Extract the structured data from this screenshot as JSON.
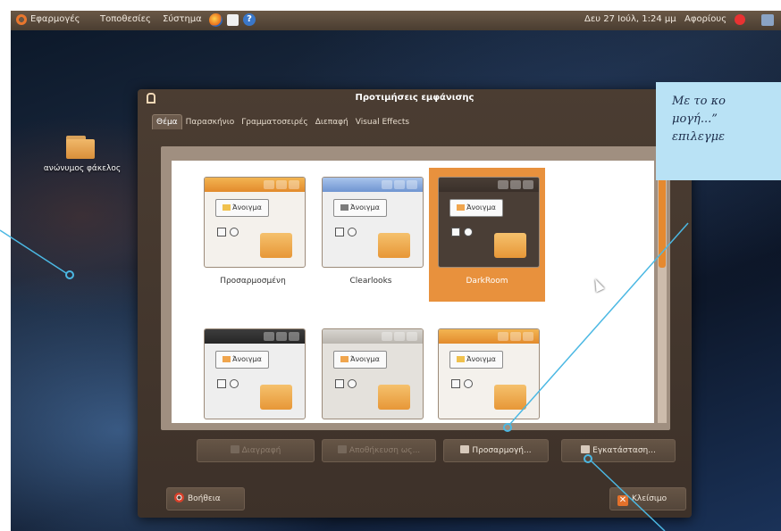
{
  "panel": {
    "menu": [
      "Εφαρμογές",
      "Τοποθεσίες",
      "Σύστημα"
    ],
    "clock": "Δευ 27 Ιούλ, 1:24 μμ",
    "user": "Αφορίους"
  },
  "desktop": {
    "folder_label": "ανώνυμος φάκελος"
  },
  "dialog": {
    "title": "Προτιμήσεις εμφάνισης",
    "tabs": [
      "Θέμα",
      "Παρασκήνιο",
      "Γραμματοσειρές",
      "Διεπαφή",
      "Visual Effects"
    ],
    "preview_button": "Άνοιγμα",
    "themes": [
      {
        "label": "Προσαρμοσμένη",
        "style": "custom"
      },
      {
        "label": "Clearlooks",
        "style": "clearlooks"
      },
      {
        "label": "DarkRoom",
        "style": "darkroom",
        "selected": true
      },
      {
        "label": "",
        "style": "dark"
      },
      {
        "label": "",
        "style": "grey"
      },
      {
        "label": "",
        "style": "custom"
      }
    ],
    "actions": [
      "Διαγραφή",
      "Αποθήκευση ως...",
      "Προσαρμογή...",
      "Εγκατάσταση..."
    ],
    "help": "Βοήθεια",
    "close": "Κλείσιμο"
  },
  "callout": {
    "text": "Με το κο\nμογή...”\nεπιλεγμε"
  },
  "colors": {
    "accent": "#e8913d",
    "callout": "#b9e2f5",
    "leader": "#4bb8e3"
  }
}
